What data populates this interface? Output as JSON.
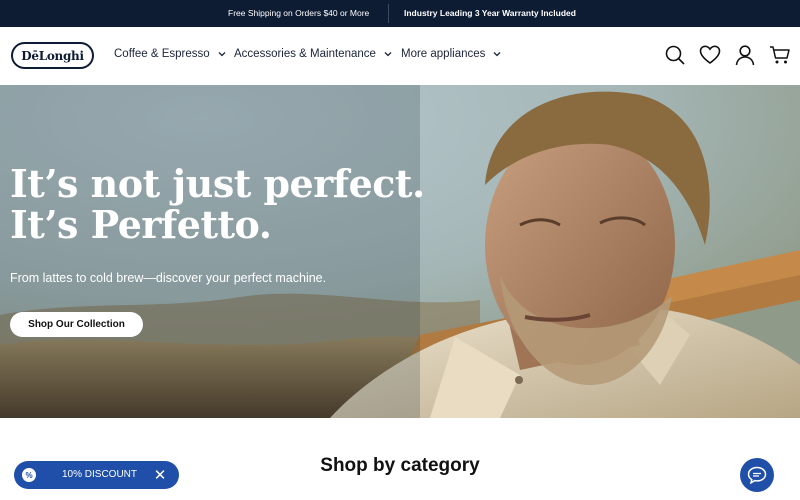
{
  "announcement": {
    "left": "Free Shipping on Orders $40 or More",
    "right": "Industry Leading 3 Year Warranty Included"
  },
  "header": {
    "logo": "DēLonghi",
    "nav": [
      {
        "label": "Coffee & Espresso"
      },
      {
        "label": "Accessories & Maintenance"
      },
      {
        "label": "More appliances"
      }
    ],
    "icons": [
      "search-icon",
      "heart-icon",
      "account-icon",
      "cart-icon"
    ]
  },
  "hero": {
    "title_line1": "It’s not just perfect.",
    "title_line2": "It’s Perfetto.",
    "subtitle": "From lattes to cold brew—discover your perfect machine.",
    "cta": "Shop Our Collection"
  },
  "section": {
    "title": "Shop by category"
  },
  "discount": {
    "icon": "%",
    "label": "10% DISCOUNT",
    "close": "✕"
  },
  "chat": {
    "icon": "chat-icon"
  },
  "colors": {
    "navy": "#0d1b33",
    "accent_blue": "#1f4fa8"
  }
}
